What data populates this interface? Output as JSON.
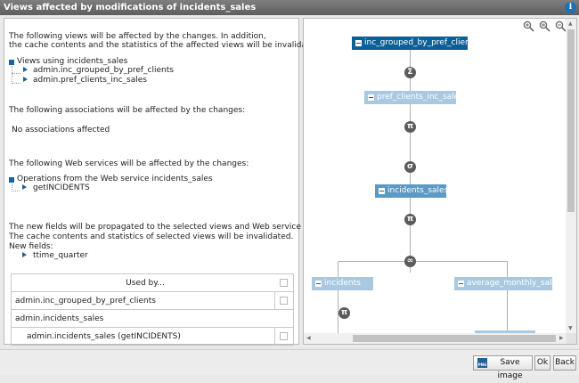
{
  "window": {
    "title": "Views affected by modifications of incidents_sales",
    "info": "i"
  },
  "left": {
    "views_intro_1": "The following views will be affected by the changes. In addition,",
    "views_intro_2": "the cache contents and the statistics of the affected views will be invalidated:",
    "views_group": "Views using incidents_sales",
    "views": [
      "admin.inc_grouped_by_pref_clients",
      "admin.pref_clients_inc_sales"
    ],
    "assoc_intro": "The following associations will be affected by the changes:",
    "assoc_none": "No associations affected",
    "ws_intro": "The following Web services will be affected by the changes:",
    "ws_group": "Operations from the Web service incidents_sales",
    "ws_ops": [
      "getINCIDENTS"
    ],
    "new_fields_1": "The new fields will be propagated to the selected views and Web service operations.",
    "new_fields_2": "The cache contents and statistics of selected views will be invalidated.",
    "new_fields_label": "New fields:",
    "fields": [
      "ttime_quarter"
    ],
    "table": {
      "header": "Used by...",
      "rows": [
        "admin.inc_grouped_by_pref_clients",
        "admin.incidents_sales",
        "admin.incidents_sales (getINCIDENTS)"
      ]
    }
  },
  "graph": {
    "nodes": [
      "inc_grouped_by_pref_clients",
      "pref_clients_inc_sales",
      "incidents_sales",
      "incidents",
      "average_monthly_sales"
    ],
    "ops": {
      "group": "Σ",
      "project": "π",
      "select": "σ",
      "join": "∞"
    }
  },
  "colors": {
    "node_dark": "#0e5f96",
    "node_mid": "#5d99c2",
    "node_light": "#a8c9e0",
    "tree": "#1f5f9a"
  },
  "footer": {
    "save_image": "Save image",
    "ok": "Ok",
    "back": "Back",
    "png_icon": "PNG"
  }
}
